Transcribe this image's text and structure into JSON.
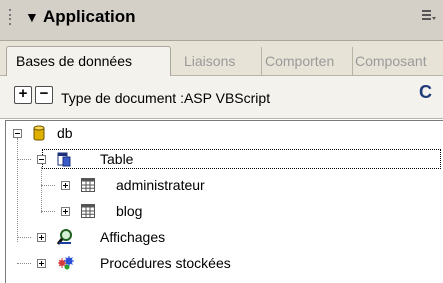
{
  "panel": {
    "title": "Application",
    "collapse_arrow": "▼"
  },
  "tabs": [
    {
      "label": "Bases de données",
      "active": true
    },
    {
      "label": "Liaisons",
      "active": false
    },
    {
      "label": "Comporten",
      "active": false
    },
    {
      "label": "Composant",
      "active": false
    }
  ],
  "toolbar": {
    "add_label": "+",
    "remove_label": "−",
    "doc_type_text": "Type de document :ASP VBScript",
    "refresh_glyph": "C"
  },
  "tree": {
    "root": {
      "label": "db",
      "icon": "database-icon"
    },
    "table": {
      "label": "Table",
      "icon": "table-icon"
    },
    "tables": [
      {
        "label": "administrateur",
        "icon": "grid-table-icon"
      },
      {
        "label": "blog",
        "icon": "grid-table-icon"
      }
    ],
    "views": {
      "label": "Affichages",
      "icon": "magnifier-view-icon"
    },
    "procs": {
      "label": "Procédures stockées",
      "icon": "stored-procedure-icon"
    }
  },
  "colors": {
    "titlebar": "#d4d0c8",
    "tabs_bg": "#e7e3d6",
    "toolbar_bg": "#f3f2ec",
    "db_icon": "#e0b000",
    "view_icon": "#2a8a2a",
    "refresh": "#1f3b7a"
  }
}
